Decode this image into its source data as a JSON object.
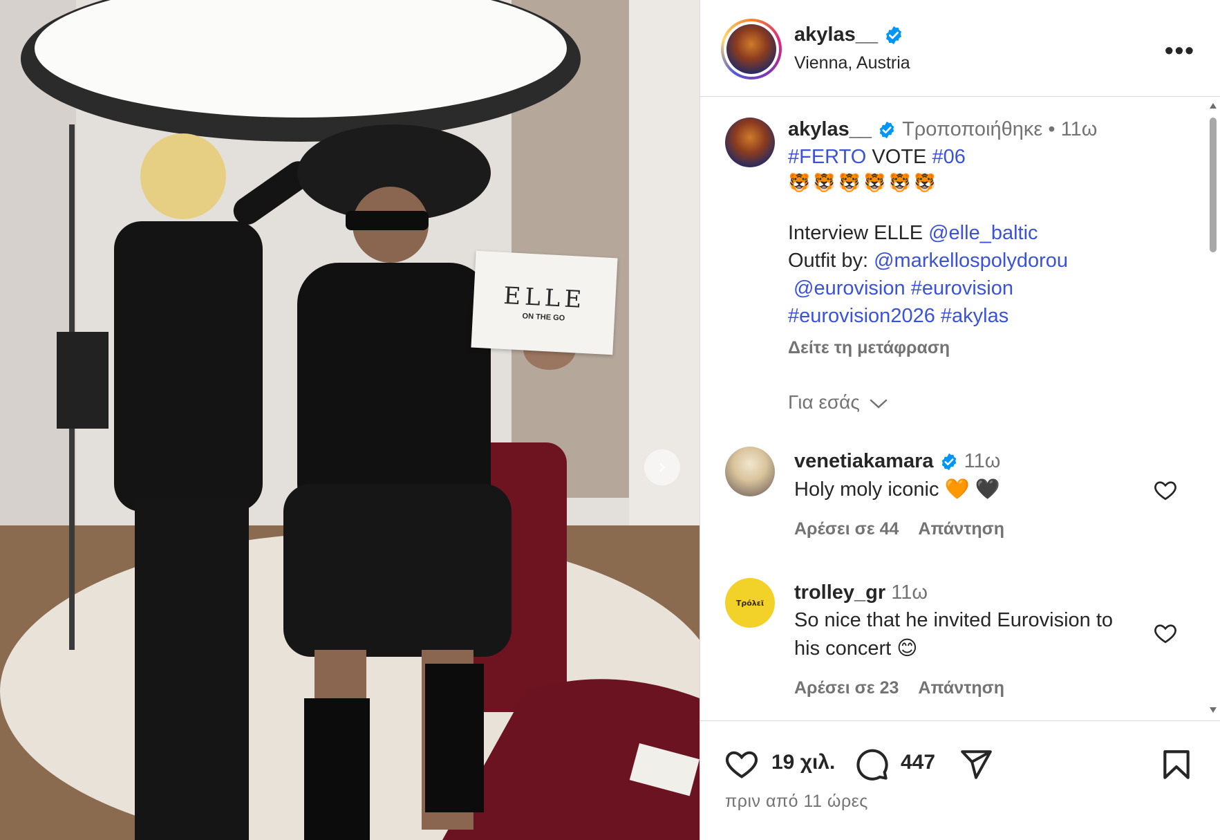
{
  "post": {
    "username": "akylas__",
    "location": "Vienna, Austria",
    "edited_label": "Τροποποιήθηκε",
    "time": "11ω",
    "caption": {
      "line1_hashtag1": "#FERTO",
      "line1_text": " VOTE ",
      "line1_hashtag2": "#06",
      "emojis": "🐯🐯🐯🐯🐯🐯",
      "line3_text": "Interview ELLE ",
      "line3_mention": "@elle_baltic",
      "line4_text": "Outfit by: ",
      "line4_mention": "@markellospolydorou",
      "line5_mention": "@eurovision",
      "line5_hashtag": "#eurovision",
      "line6_hashtag1": "#eurovision2026",
      "line6_hashtag2": "#akylas"
    },
    "see_translation": "Δείτε τη μετάφραση",
    "for_you": "Για εσάς",
    "likes": "19 χιλ.",
    "comments_count": "447",
    "time_ago": "πριν από 11 ώρες"
  },
  "photo": {
    "card_logo": "ELLE",
    "card_sub": "ON THE GO"
  },
  "comments": [
    {
      "username": "venetiakamara",
      "time": "11ω",
      "text": "Holy moly iconic 🧡 🖤",
      "likes": "Αρέσει σε 44",
      "reply": "Απάντηση"
    },
    {
      "username": "trolley_gr",
      "time": "11ω",
      "text_line1": "So nice that he invited Eurovision to",
      "text_line2": "his concert 😊",
      "likes": "Αρέσει σε 23",
      "reply": "Απάντηση",
      "avatar_text": "Τρόλεϊ"
    }
  ],
  "icons": {
    "verified": "verified-badge-icon",
    "more": "more-options-icon",
    "heart": "heart-icon",
    "comment": "comment-icon",
    "share": "send-icon",
    "save": "bookmark-icon",
    "next": "chevron-right-icon"
  },
  "colors": {
    "link": "#3a52d8",
    "verified": "#0095f6",
    "muted": "#737373"
  }
}
